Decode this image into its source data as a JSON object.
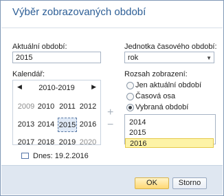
{
  "dialog": {
    "title": "Výběr zobrazovaných období"
  },
  "current_period": {
    "label": "Aktuální období:",
    "value": "2015"
  },
  "time_unit": {
    "label": "Jednotka časového období:",
    "value": "rok"
  },
  "calendar": {
    "label": "Kalendář:",
    "range": "2010-2019",
    "years": [
      "2009",
      "2010",
      "2011",
      "2012",
      "2013",
      "2014",
      "2015",
      "2016",
      "2017",
      "2018",
      "2019",
      "2020"
    ],
    "selected_year": "2015",
    "today_label": "Dnes: 19.2.2016"
  },
  "display_range": {
    "label": "Rozsah zobrazení:",
    "options": [
      "Jen aktuální období",
      "Časová osa",
      "Vybraná období"
    ],
    "selected": "Vybraná období"
  },
  "selected_periods": {
    "items": [
      "2014",
      "2015",
      "2016"
    ],
    "selected": "2016"
  },
  "buttons": {
    "ok": "OK",
    "cancel": "Storno"
  },
  "icons": {
    "add": "+",
    "remove": "−",
    "prev": "◀",
    "next": "▶",
    "combo": "▼"
  }
}
